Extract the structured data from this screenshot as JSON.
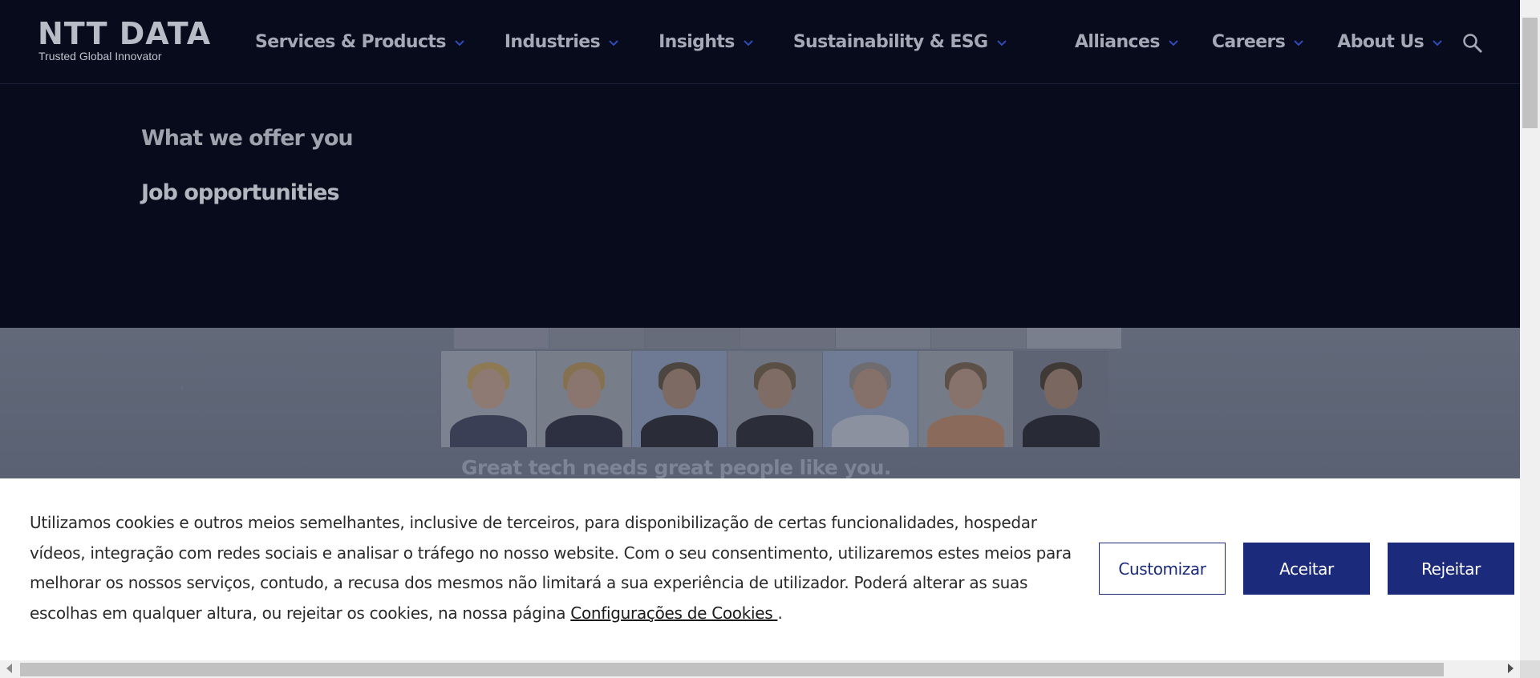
{
  "header": {
    "logo_main": "NTT DATA",
    "logo_sub": "Trusted Global Innovator",
    "nav_left": [
      {
        "label": "Services & Products"
      },
      {
        "label": "Industries"
      },
      {
        "label": "Insights"
      },
      {
        "label": "Sustainability & ESG"
      }
    ],
    "nav_right": [
      {
        "label": "Alliances"
      },
      {
        "label": "Careers"
      },
      {
        "label": "About Us"
      }
    ],
    "search_icon": "search-icon"
  },
  "dropdown": {
    "items": [
      {
        "label": "What we offer you"
      },
      {
        "label": "Job opportunities"
      }
    ]
  },
  "hero": {
    "tagline": "Great tech needs great people like you."
  },
  "cookie": {
    "text_lines": [
      "Utilizamos cookies e outros meios semelhantes, inclusive de terceiros, para disponibilização de certas funcionalidades, hospedar",
      "vídeos, integração com redes sociais e analisar o tráfego no nosso website. Com o seu consentimento, utilizaremos estes meios para",
      "melhorar os nossos serviços, contudo, a recusa dos mesmos não limitará a sua experiência de utilizador. Poderá alterar as suas",
      "escolhas em qualquer altura, ou rejeitar os cookies, na nossa página "
    ],
    "link_text": "Configurações de Cookies ",
    "after_link": ".",
    "buttons": {
      "customize": "Customizar",
      "accept": "Aceitar",
      "reject": "Rejeitar"
    }
  },
  "colors": {
    "header_bg": "#070b1c",
    "nav_text": "#a5a9b5",
    "chevron": "#2f4bb8",
    "button_primary": "#1b2a7a"
  }
}
